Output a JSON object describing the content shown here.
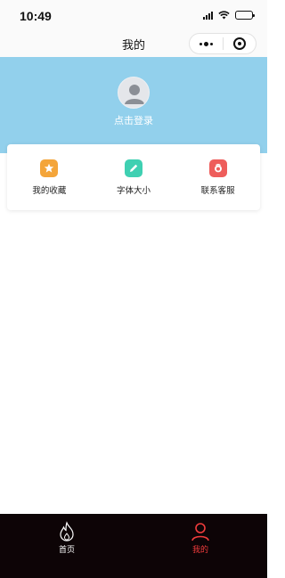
{
  "status_bar": {
    "time": "10:49"
  },
  "nav": {
    "title": "我的"
  },
  "profile": {
    "login_text": "点击登录"
  },
  "actions": [
    {
      "label": "我的收藏",
      "icon": "star-icon",
      "color": "#f4a53a"
    },
    {
      "label": "字体大小",
      "icon": "pencil-icon",
      "color": "#3fd0b2"
    },
    {
      "label": "联系客服",
      "icon": "service-icon",
      "color": "#ee5d5b"
    }
  ],
  "tab_bar": {
    "items": [
      {
        "label": "首页",
        "icon": "flame-icon",
        "active": false,
        "color": "#ffffff"
      },
      {
        "label": "我的",
        "icon": "user-icon",
        "active": true,
        "color": "#f03c3c"
      }
    ]
  },
  "colors": {
    "header_bg": "#92d0ec",
    "tab_bar_bg": "#0d0406",
    "active_tab": "#f03c3c"
  }
}
